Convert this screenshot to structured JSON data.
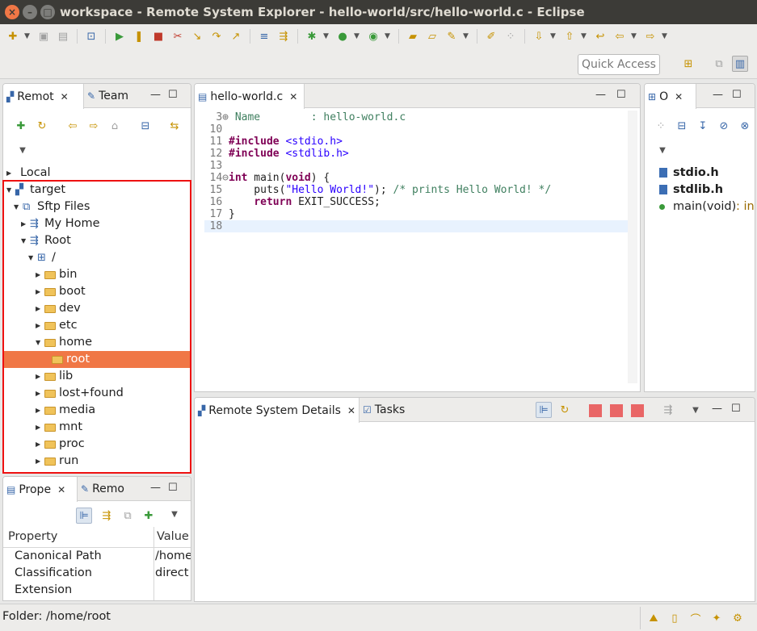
{
  "window": {
    "title": "workspace - Remote System Explorer - hello-world/src/hello-world.c - Eclipse"
  },
  "toolbar": {
    "quick_access_label": "Quick Access"
  },
  "remote_panel": {
    "tabs": [
      {
        "label": "Remot"
      },
      {
        "label": "Team"
      }
    ],
    "tree": [
      {
        "label": "Local",
        "indent": 0,
        "expanded": false,
        "icon": "local-computer-icon"
      },
      {
        "label": "target",
        "indent": 0,
        "expanded": true,
        "icon": "remote-host-icon"
      },
      {
        "label": "Sftp Files",
        "indent": 1,
        "expanded": true,
        "icon": "sftp-files-icon"
      },
      {
        "label": "My Home",
        "indent": 2,
        "expanded": false,
        "icon": "filter-icon"
      },
      {
        "label": "Root",
        "indent": 2,
        "expanded": true,
        "icon": "filter-icon"
      },
      {
        "label": "/",
        "indent": 3,
        "expanded": true,
        "icon": "root-drive-icon"
      },
      {
        "label": "bin",
        "indent": 4,
        "expanded": false,
        "icon": "folder-icon"
      },
      {
        "label": "boot",
        "indent": 4,
        "expanded": false,
        "icon": "folder-icon"
      },
      {
        "label": "dev",
        "indent": 4,
        "expanded": false,
        "icon": "folder-icon"
      },
      {
        "label": "etc",
        "indent": 4,
        "expanded": false,
        "icon": "folder-icon"
      },
      {
        "label": "home",
        "indent": 4,
        "expanded": true,
        "icon": "folder-open-icon"
      },
      {
        "label": "root",
        "indent": 5,
        "expanded": null,
        "icon": "folder-icon",
        "selected": true
      },
      {
        "label": "lib",
        "indent": 4,
        "expanded": false,
        "icon": "folder-icon"
      },
      {
        "label": "lost+found",
        "indent": 4,
        "expanded": false,
        "icon": "folder-icon"
      },
      {
        "label": "media",
        "indent": 4,
        "expanded": false,
        "icon": "folder-icon"
      },
      {
        "label": "mnt",
        "indent": 4,
        "expanded": false,
        "icon": "folder-icon"
      },
      {
        "label": "proc",
        "indent": 4,
        "expanded": false,
        "icon": "folder-icon"
      },
      {
        "label": "run",
        "indent": 4,
        "expanded": false,
        "icon": "folder-icon"
      }
    ]
  },
  "properties_panel": {
    "tabs": [
      {
        "label": "Prope"
      },
      {
        "label": "Remo"
      }
    ],
    "columns": {
      "property": "Property",
      "value": "Value"
    },
    "rows": [
      {
        "property": "Canonical Path",
        "value": "/home"
      },
      {
        "property": "Classification",
        "value": "direct"
      },
      {
        "property": "Extension",
        "value": ""
      }
    ]
  },
  "editor": {
    "tab_label": "hello-world.c",
    "lines": [
      {
        "num": "3",
        "marker": "⊕",
        "text": " Name        : hello-world.c"
      },
      {
        "num": "10",
        "text": ""
      },
      {
        "num": "11",
        "text": "#include <stdio.h>"
      },
      {
        "num": "12",
        "text": "#include <stdlib.h>"
      },
      {
        "num": "13",
        "text": ""
      },
      {
        "num": "14",
        "marker": "⊖",
        "text": "int main(void) {"
      },
      {
        "num": "15",
        "text": "    puts(\"Hello World!\"); /* prints Hello World! */"
      },
      {
        "num": "16",
        "text": "    return EXIT_SUCCESS;"
      },
      {
        "num": "17",
        "text": "}"
      },
      {
        "num": "18",
        "text": "",
        "current": true
      }
    ]
  },
  "outline_panel": {
    "tab_label": "O",
    "items": [
      {
        "label": "stdio.h",
        "kind": "include",
        "bold": true
      },
      {
        "label": "stdlib.h",
        "kind": "include",
        "bold": true
      },
      {
        "label": "main(void)",
        "suffix": " : in",
        "kind": "function"
      }
    ]
  },
  "details_panel": {
    "tabs": [
      {
        "label": "Remote System Details"
      },
      {
        "label": "Tasks"
      }
    ]
  },
  "statusbar": {
    "text": "Folder: /home/root"
  },
  "colors": {
    "selection": "#f07746",
    "highlight_box": "#ee1111",
    "keyword": "#7f0055",
    "string": "#2a00ff",
    "comment": "#3f7f5f"
  }
}
